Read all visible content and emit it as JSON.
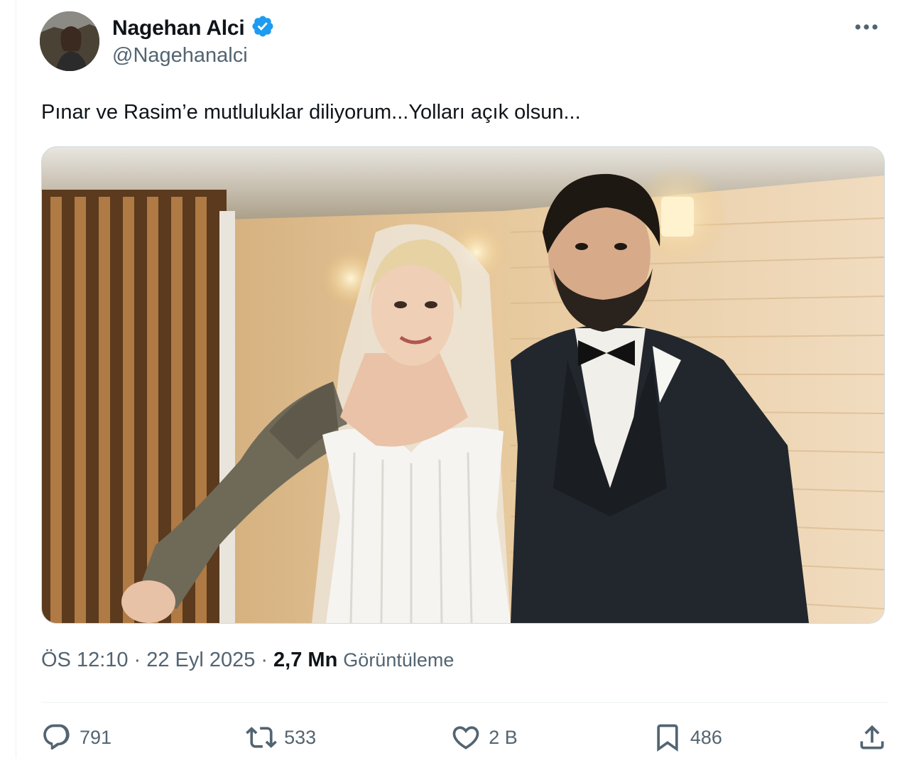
{
  "author": {
    "display_name": "Nagehan Alci",
    "handle": "@Nagehanalci",
    "avatar_icon": "profile-photo",
    "verified_icon": "verified-badge-icon",
    "verified_color": "#1d9bf0"
  },
  "tweet": {
    "text": "Pınar ve Rasim’e mutluluklar diliyorum...Yolları açık olsun...",
    "media_icon": "wedding-photo"
  },
  "meta": {
    "time": "ÖS 12:10",
    "separator": "·",
    "date": "22 Eyl 2025",
    "views_count": "2,7 Mn",
    "views_label": "Görüntüleme"
  },
  "actions": {
    "reply_count": "791",
    "retweet_count": "533",
    "like_count": "2 B",
    "bookmark_count": "486"
  },
  "colors": {
    "text_primary": "#0f1419",
    "text_secondary": "#536471",
    "border": "#eff3f4"
  }
}
